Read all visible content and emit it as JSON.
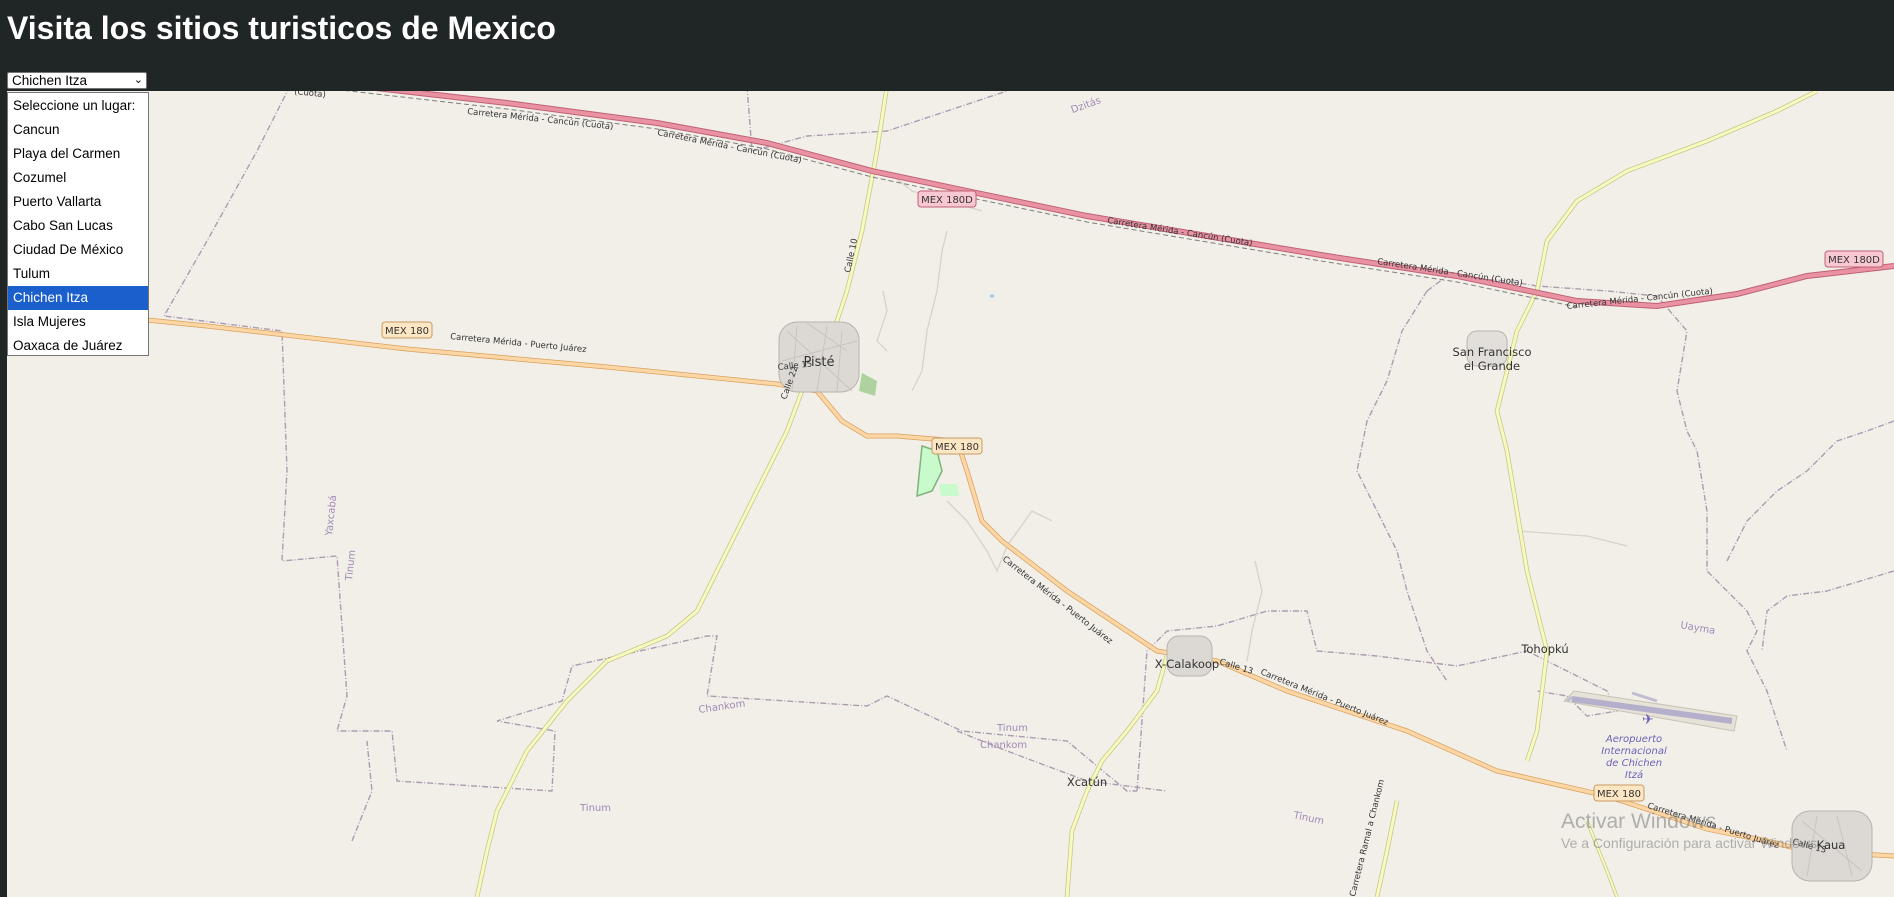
{
  "header": {
    "title": "Visita los sitios turisticos de Mexico"
  },
  "select": {
    "value": "Chichen Itza",
    "options": [
      "Seleccione un lugar:",
      "Cancun",
      "Playa del Carmen",
      "Cozumel",
      "Puerto Vallarta",
      "Cabo San Lucas",
      "Ciudad De México",
      "Tulum",
      "Chichen Itza",
      "Isla Mujeres",
      "Oaxaca de Juárez"
    ],
    "selected_index": 8
  },
  "map": {
    "places": {
      "piste": "Pisté",
      "san_francisco_1": "San Francisco",
      "san_francisco_2": "el Grande",
      "x_calakoop": "X-Calakoop",
      "tohopku": "Tohopkú",
      "xcatun": "Xcatún",
      "kaua": "Kaua",
      "dzitas": "Dzitás",
      "airport_1": "Aeropuerto",
      "airport_2": "Internacional",
      "airport_3": "de Chichen",
      "airport_4": "Itzá"
    },
    "shields": {
      "mex180d_a": "MEX 180D",
      "mex180d_b": "MEX 180D",
      "mex180_a": "MEX 180",
      "mex180_b": "MEX 180",
      "mex180_c": "MEX 180"
    },
    "roads": {
      "cuota_1": "Carretera Mérida - Cancún (Cuota)",
      "cuota_2": "Carretera Mérida - Cancún (Cuota)",
      "cuota_3": "Carretera Mérida - Cancún (Cuota)",
      "cuota_4": "Carretera Mérida - Cancún (Cuota)",
      "cuota_5": "Carretera Mérida - Cancún (Cuota)",
      "cuota_edge": "(Cuota)",
      "pj_1": "Carretera Mérida - Puerto Juárez",
      "pj_2": "Carretera Mérida - Puerto Juárez",
      "pj_3": "Carretera Mérida - Puerto Juárez",
      "pj_4": "Carretera Mérida - Puerto Juárez",
      "calle10": "Calle 10",
      "calle15": "Calle 15",
      "calle22": "Calle 22",
      "calle13": "Calle 13",
      "calle13b": "Calle 13",
      "chankom_rd": "Carretera Ramal a Chankom"
    },
    "boundaries": {
      "yaxcaba": "Yaxcabá",
      "tinum_1": "Tinum",
      "tinum_2": "Tinum",
      "tinum_3": "Tinum",
      "tinum_4": "Tinum",
      "chankom_1": "Chankom",
      "chankom_2": "Chankom",
      "uayma": "Uayma",
      "kaua_b": "Kaua"
    }
  },
  "watermark": {
    "line1": "Activar Windows",
    "line2": "Ve a Configuración para activar Windows."
  },
  "colors": {
    "header_bg": "#202526",
    "map_bg": "#f2efe9",
    "motorway": "#e892a2",
    "primary_road": "#fcd6a4",
    "secondary_road": "#f7fabf",
    "boundary": "#ac9bb1",
    "selected_option": "#1a5fcb"
  }
}
